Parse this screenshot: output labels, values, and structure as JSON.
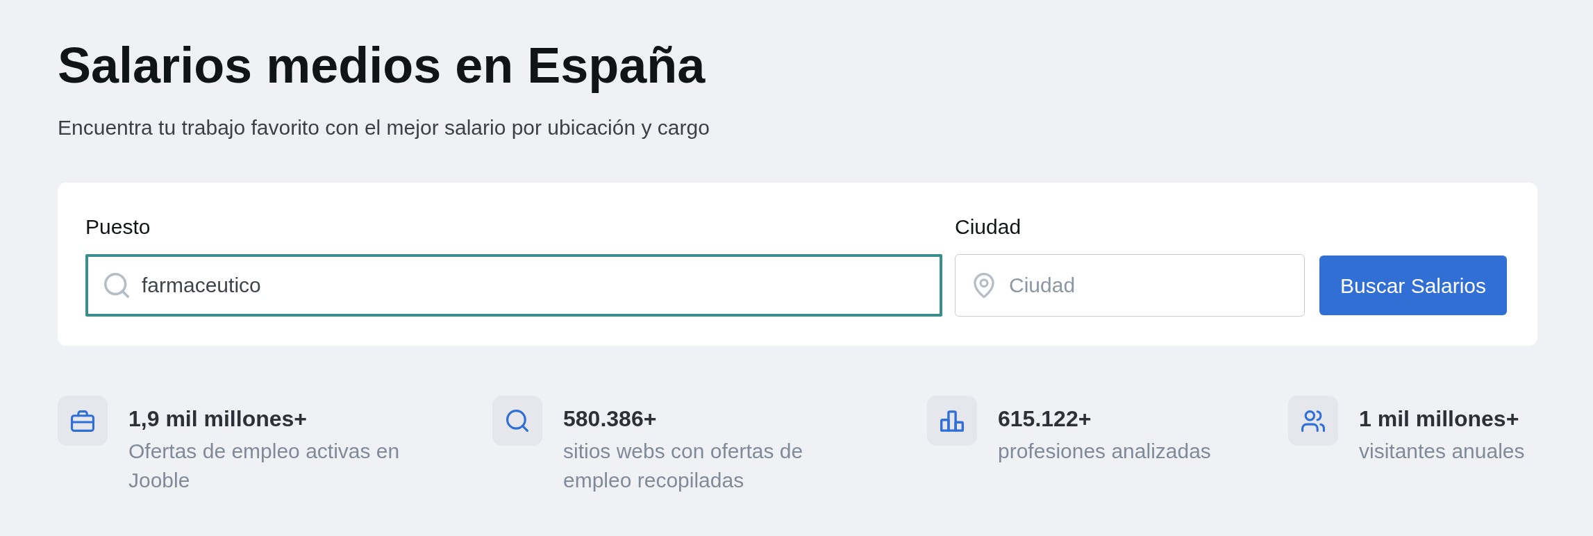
{
  "header": {
    "title": "Salarios medios en España",
    "subtitle": "Encuentra tu trabajo favorito con el mejor salario por ubicación y cargo"
  },
  "search_form": {
    "fields": [
      {
        "label": "Puesto",
        "value": "farmaceutico",
        "focused": true
      },
      {
        "label": "Ciudad",
        "placeholder": "Ciudad",
        "focused": false
      }
    ],
    "button": "Buscar Salarios"
  },
  "stats": [
    {
      "value": "1,9 mil millones+",
      "description": "Ofertas de empleo activas en Jooble"
    },
    {
      "value": "580.386+",
      "description": "sitios webs con ofertas de empleo recopiladas"
    },
    {
      "value": "615.122+",
      "description": "profesiones analizadas"
    },
    {
      "value": "1 mil millones+",
      "description": "visitantes anuales"
    }
  ]
}
